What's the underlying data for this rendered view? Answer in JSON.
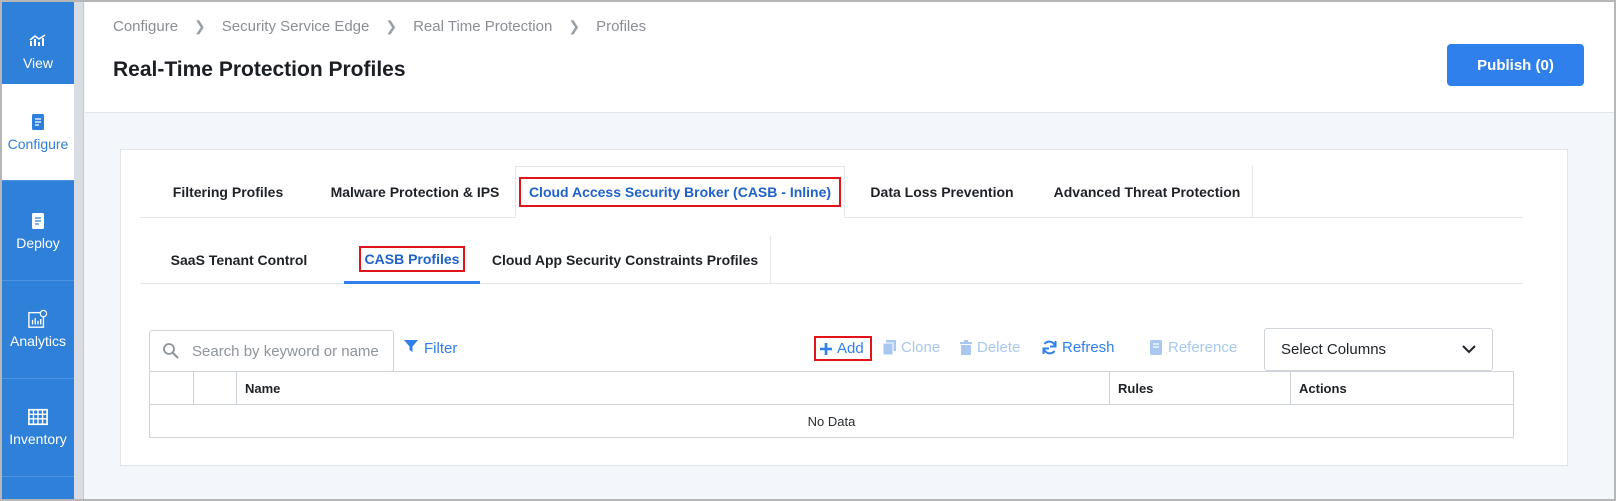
{
  "sidebar": {
    "items": [
      {
        "label": "View",
        "icon": "chart-icon"
      },
      {
        "label": "Configure",
        "icon": "document-icon"
      },
      {
        "label": "Deploy",
        "icon": "document-icon"
      },
      {
        "label": "Analytics",
        "icon": "analytics-icon"
      },
      {
        "label": "Inventory",
        "icon": "inventory-icon"
      }
    ]
  },
  "header": {
    "breadcrumb": [
      "Configure",
      "Security Service Edge",
      "Real Time Protection",
      "Profiles"
    ],
    "title": "Real-Time Protection Profiles",
    "publish_label": "Publish (0)"
  },
  "tabs_primary": [
    {
      "label": "Filtering Profiles"
    },
    {
      "label": "Malware Protection & IPS"
    },
    {
      "label": "Cloud Access Security Broker (CASB - Inline)"
    },
    {
      "label": "Data Loss Prevention"
    },
    {
      "label": "Advanced Threat Protection"
    }
  ],
  "tabs_secondary": [
    {
      "label": "SaaS Tenant Control"
    },
    {
      "label": "CASB Profiles"
    },
    {
      "label": "Cloud App Security Constraints Profiles"
    }
  ],
  "toolbar": {
    "search_placeholder": "Search by keyword or name",
    "filter_label": "Filter",
    "add_label": "Add",
    "clone_label": "Clone",
    "delete_label": "Delete",
    "refresh_label": "Refresh",
    "reference_label": "Reference",
    "select_columns_label": "Select Columns"
  },
  "table": {
    "columns": [
      "",
      "",
      "Name",
      "Rules",
      "Actions"
    ],
    "empty_text": "No Data"
  },
  "colors": {
    "sidebar": "#2f80d8",
    "accent": "#2f80ed",
    "highlight_box": "#e0141b"
  }
}
